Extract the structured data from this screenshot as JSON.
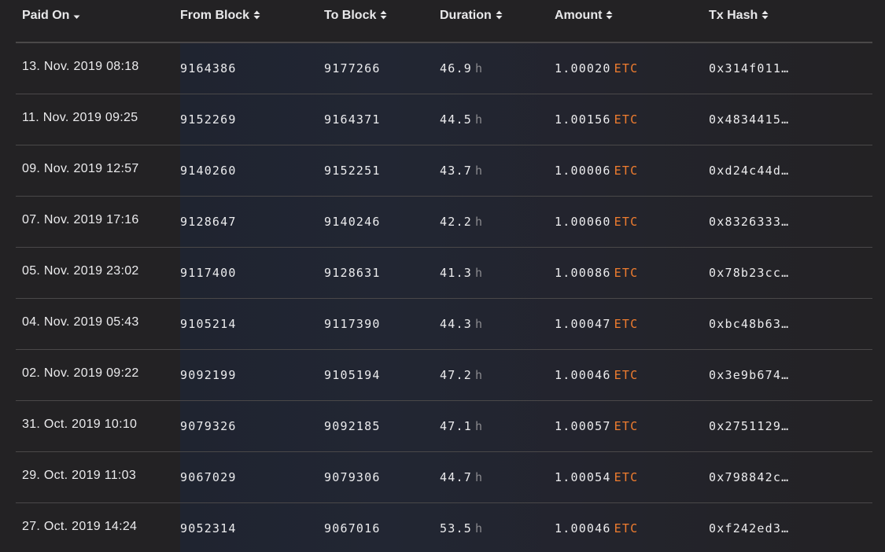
{
  "columns": [
    {
      "label": "Paid On",
      "sort": "desc"
    },
    {
      "label": "From Block",
      "sort": "both"
    },
    {
      "label": "To Block",
      "sort": "both"
    },
    {
      "label": "Duration",
      "sort": "both"
    },
    {
      "label": "Amount",
      "sort": "both"
    },
    {
      "label": "Tx Hash",
      "sort": "both"
    }
  ],
  "duration_unit": "h",
  "amount_unit": "ETC",
  "colors": {
    "background": "#232224",
    "accent": "#f07d2f",
    "unit_gray": "#8a8a8e",
    "divider": "#4a4849"
  },
  "rows": [
    {
      "paid_on": "13. Nov. 2019 08:18",
      "from_block": "9164386",
      "to_block": "9177266",
      "duration": "46.9",
      "amount": "1.00020",
      "tx_hash": "0x314f011…"
    },
    {
      "paid_on": "11. Nov. 2019 09:25",
      "from_block": "9152269",
      "to_block": "9164371",
      "duration": "44.5",
      "amount": "1.00156",
      "tx_hash": "0x4834415…"
    },
    {
      "paid_on": "09. Nov. 2019 12:57",
      "from_block": "9140260",
      "to_block": "9152251",
      "duration": "43.7",
      "amount": "1.00006",
      "tx_hash": "0xd24c44d…"
    },
    {
      "paid_on": "07. Nov. 2019 17:16",
      "from_block": "9128647",
      "to_block": "9140246",
      "duration": "42.2",
      "amount": "1.00060",
      "tx_hash": "0x8326333…"
    },
    {
      "paid_on": "05. Nov. 2019 23:02",
      "from_block": "9117400",
      "to_block": "9128631",
      "duration": "41.3",
      "amount": "1.00086",
      "tx_hash": "0x78b23cc…"
    },
    {
      "paid_on": "04. Nov. 2019 05:43",
      "from_block": "9105214",
      "to_block": "9117390",
      "duration": "44.3",
      "amount": "1.00047",
      "tx_hash": "0xbc48b63…"
    },
    {
      "paid_on": "02. Nov. 2019 09:22",
      "from_block": "9092199",
      "to_block": "9105194",
      "duration": "47.2",
      "amount": "1.00046",
      "tx_hash": "0x3e9b674…"
    },
    {
      "paid_on": "31. Oct. 2019 10:10",
      "from_block": "9079326",
      "to_block": "9092185",
      "duration": "47.1",
      "amount": "1.00057",
      "tx_hash": "0x2751129…"
    },
    {
      "paid_on": "29. Oct. 2019 11:03",
      "from_block": "9067029",
      "to_block": "9079306",
      "duration": "44.7",
      "amount": "1.00054",
      "tx_hash": "0x798842c…"
    },
    {
      "paid_on": "27. Oct. 2019 14:24",
      "from_block": "9052314",
      "to_block": "9067016",
      "duration": "53.5",
      "amount": "1.00046",
      "tx_hash": "0xf242ed3…"
    }
  ]
}
